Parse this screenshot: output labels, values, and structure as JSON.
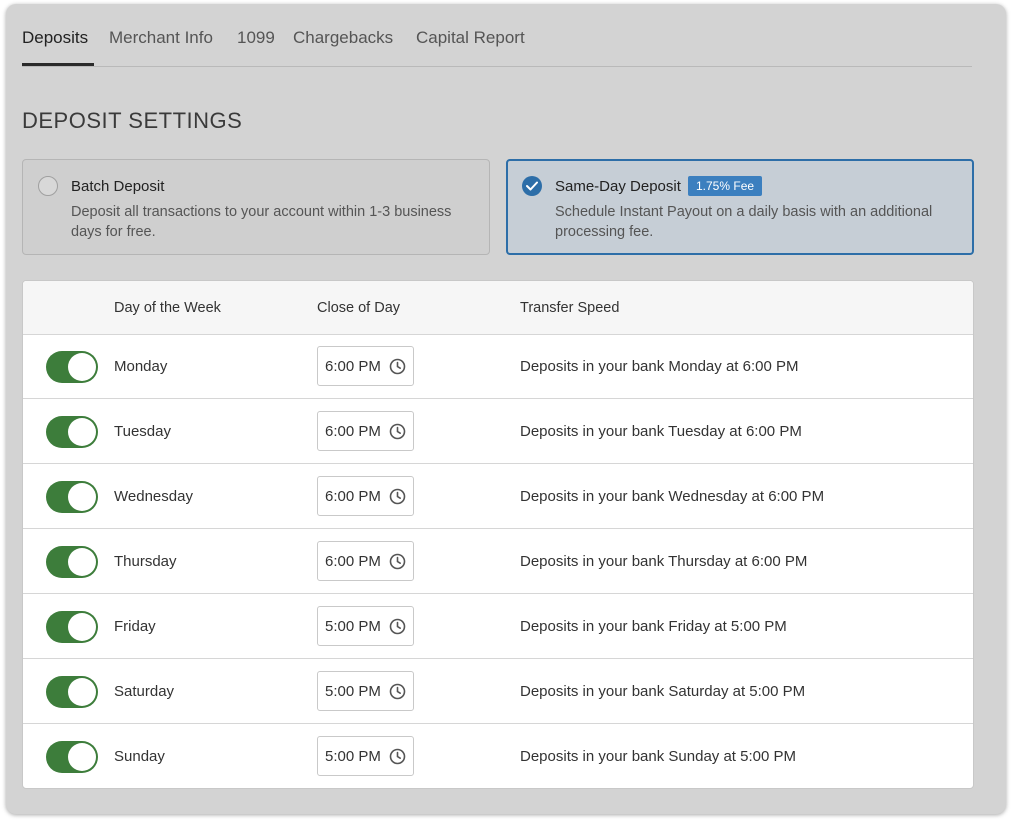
{
  "tabs": [
    {
      "label": "Deposits",
      "active": true
    },
    {
      "label": "Merchant Info",
      "active": false
    },
    {
      "label": "1099",
      "active": false
    },
    {
      "label": "Chargebacks",
      "active": false
    },
    {
      "label": "Capital Report",
      "active": false
    }
  ],
  "section_title": "DEPOSIT SETTINGS",
  "options": {
    "batch": {
      "title": "Batch Deposit",
      "description": "Deposit all transactions to your account within 1-3 business days for free.",
      "selected": false
    },
    "sameday": {
      "title": "Same-Day Deposit",
      "badge": "1.75% Fee",
      "description": "Schedule Instant Payout on a daily basis with an additional processing fee.",
      "selected": true
    }
  },
  "table": {
    "headers": {
      "day": "Day of the Week",
      "close": "Close of Day",
      "speed": "Transfer Speed"
    },
    "rows": [
      {
        "day": "Monday",
        "enabled": true,
        "time": "6:00 PM",
        "transfer": "Deposits in your bank Monday at 6:00 PM"
      },
      {
        "day": "Tuesday",
        "enabled": true,
        "time": "6:00 PM",
        "transfer": "Deposits in your bank Tuesday at 6:00 PM"
      },
      {
        "day": "Wednesday",
        "enabled": true,
        "time": "6:00 PM",
        "transfer": "Deposits in your bank Wednesday at 6:00 PM"
      },
      {
        "day": "Thursday",
        "enabled": true,
        "time": "6:00 PM",
        "transfer": "Deposits in your bank Thursday at 6:00 PM"
      },
      {
        "day": "Friday",
        "enabled": true,
        "time": "5:00 PM",
        "transfer": "Deposits in your bank Friday at 5:00 PM"
      },
      {
        "day": "Saturday",
        "enabled": true,
        "time": "5:00 PM",
        "transfer": "Deposits in your bank Saturday at 5:00 PM"
      },
      {
        "day": "Sunday",
        "enabled": true,
        "time": "5:00 PM",
        "transfer": "Deposits in your bank Sunday at 5:00 PM"
      }
    ]
  },
  "icons": {
    "time_field": "clock-icon",
    "selected_option": "checkmark-icon"
  },
  "colors": {
    "accent_blue": "#2d6ea8",
    "badge_blue": "#3b7fbf",
    "toggle_on": "#3d7d3b"
  }
}
